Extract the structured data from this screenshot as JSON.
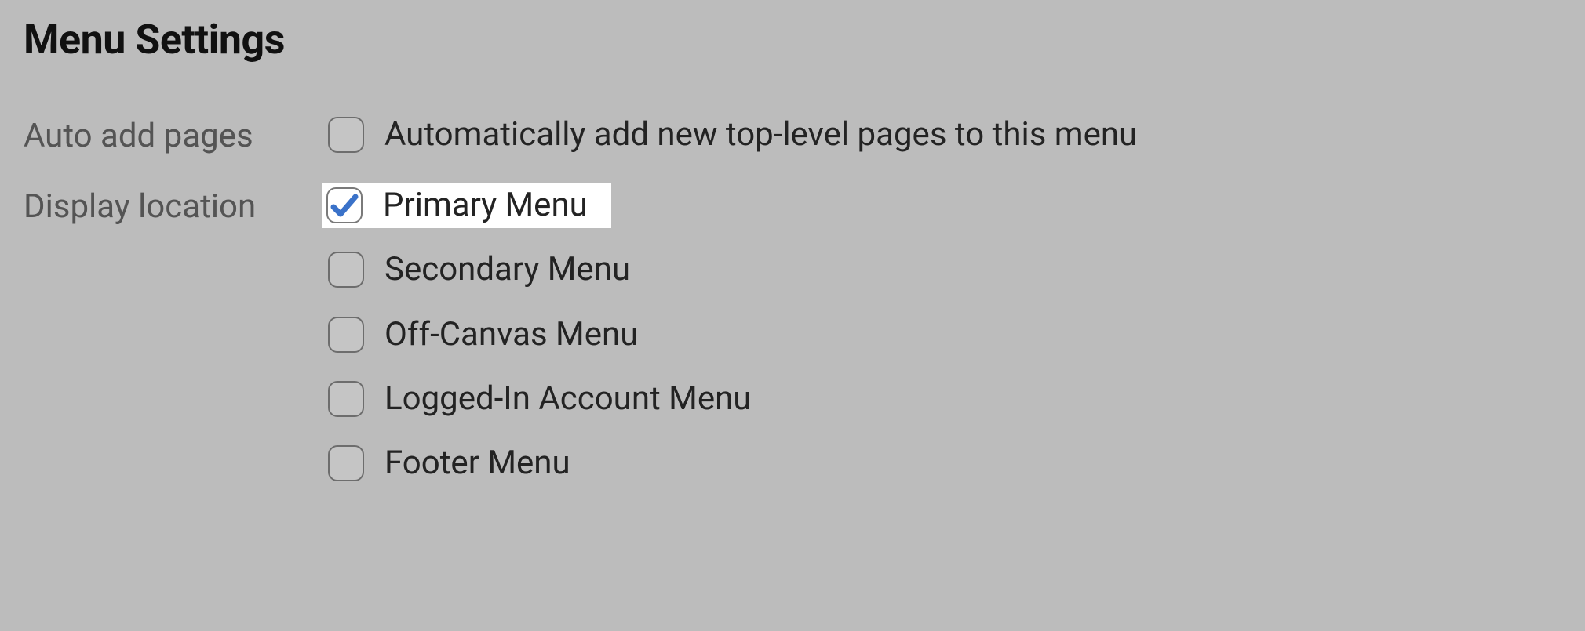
{
  "title": "Menu Settings",
  "settings": {
    "autoAdd": {
      "label": "Auto add pages",
      "option": {
        "label": "Automatically add new top-level pages to this menu",
        "checked": false
      }
    },
    "displayLocation": {
      "label": "Display location",
      "options": [
        {
          "label": "Primary Menu",
          "checked": true,
          "highlighted": true
        },
        {
          "label": "Secondary Menu",
          "checked": false,
          "highlighted": false
        },
        {
          "label": "Off-Canvas Menu",
          "checked": false,
          "highlighted": false
        },
        {
          "label": "Logged-In Account Menu",
          "checked": false,
          "highlighted": false
        },
        {
          "label": "Footer Menu",
          "checked": false,
          "highlighted": false
        }
      ]
    }
  }
}
